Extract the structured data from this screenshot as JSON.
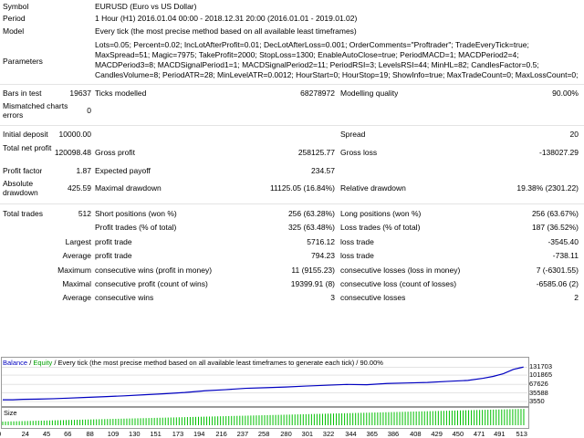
{
  "summary": {
    "symbol": {
      "label": "Symbol",
      "value": "EURUSD (Euro vs US Dollar)"
    },
    "period": {
      "label": "Period",
      "value": "1 Hour (H1) 2016.01.04 00:00 - 2018.12.31 20:00 (2016.01.01 - 2019.01.02)"
    },
    "model": {
      "label": "Model",
      "value": "Every tick (the most precise method based on all available least timeframes)"
    },
    "parameters": {
      "label": "Parameters",
      "value": "Lots=0.05; Percent=0.02; IncLotAfterProfit=0.01; DecLotAfterLoss=0.001; OrderComments=\"Proftrader\"; TradeEveryTick=true; MaxSpread=51; Magic=7975; TakeProfit=2000; StopLoss=1300; EnableAutoClose=true; PeriodMACD=1; MACDPeriod2=4; MACDPeriod3=8; MACDSignalPeriod1=1; MACDSignalPeriod2=11; PeriodRSI=3; LevelsRSI=44; MinHL=82; CandlesFactor=0.5; CandlesVolume=8; PeriodATR=28; MinLevelATR=0.0012; HourStart=0; HourStop=19; ShowInfo=true; MaxTradeCount=0; MaxLossCount=0;"
    }
  },
  "stats": {
    "bars_label": "Bars in test",
    "bars": "19637",
    "ticks_label": "Ticks modelled",
    "ticks": "68278972",
    "mq_label": "Modelling quality",
    "mq": "90.00%",
    "mismatch_label": "Mismatched charts errors",
    "mismatch": "0",
    "deposit_label": "Initial deposit",
    "deposit": "10000.00",
    "spread_label": "Spread",
    "spread": "20",
    "netprofit_label": "Total net profit",
    "netprofit": "120098.48",
    "grossprofit_label": "Gross profit",
    "grossprofit": "258125.77",
    "grossloss_label": "Gross loss",
    "grossloss": "-138027.29",
    "pf_label": "Profit factor",
    "pf": "1.87",
    "ep_label": "Expected payoff",
    "ep": "234.57",
    "absdd_label": "Absolute drawdown",
    "absdd": "425.59",
    "maxdd_label": "Maximal drawdown",
    "maxdd": "11125.05 (16.84%)",
    "reldd_label": "Relative drawdown",
    "reldd": "19.38% (2301.22)",
    "trades_label": "Total trades",
    "trades": "512",
    "short_label": "Short positions (won %)",
    "short": "256 (63.28%)",
    "long_label": "Long positions (won %)",
    "long": "256 (63.67%)",
    "ptrades_label": "Profit trades (% of total)",
    "ptrades": "325 (63.48%)",
    "ltrades_label": "Loss trades (% of total)",
    "ltrades": "187 (36.52%)",
    "largest_label": "Largest",
    "largest_p_label": "profit trade",
    "largest_p": "5716.12",
    "largest_l_label": "loss trade",
    "largest_l": "-3545.40",
    "average_label": "Average",
    "average_p_label": "profit trade",
    "average_p": "794.23",
    "average_l_label": "loss trade",
    "average_l": "-738.11",
    "maximum_label": "Maximum",
    "max_w_label": "consecutive wins (profit in money)",
    "max_w": "11 (9155.23)",
    "max_l_label": "consecutive losses (loss in money)",
    "max_l": "7 (-6301.55)",
    "maximal_label": "Maximal",
    "maxl_w_label": "consecutive profit (count of wins)",
    "maxl_w": "19399.91 (8)",
    "maxl_l_label": "consecutive loss (count of losses)",
    "maxl_l": "-6585.06 (2)",
    "avg2_label": "Average",
    "avg_w_label": "consecutive wins",
    "avg_w": "3",
    "avg_l_label": "consecutive losses",
    "avg_l": "2"
  },
  "legend": {
    "balance": "Balance",
    "sep1": " / ",
    "equity": "Equity",
    "rest": " / Every tick (the most precise method based on all available least timeframes to generate each tick) / 90.00%"
  },
  "size_label": "Size",
  "colors": {
    "balance": "#0000c0",
    "size_bars": "#00c000",
    "grid": "#c8c8c8"
  },
  "chart_data": {
    "type": "line",
    "series": [
      {
        "name": "Balance",
        "x": [
          0,
          10,
          20,
          35,
          50,
          65,
          80,
          100,
          120,
          140,
          160,
          180,
          200,
          220,
          240,
          260,
          280,
          300,
          320,
          340,
          360,
          380,
          400,
          420,
          440,
          460,
          475,
          485,
          495,
          505,
          515
        ],
        "values": [
          10000,
          10000,
          11500,
          12500,
          14000,
          16000,
          18500,
          21500,
          24500,
          28500,
          32500,
          37000,
          43500,
          47500,
          52500,
          55000,
          57500,
          61000,
          64000,
          67000,
          66000,
          70500,
          72500,
          74500,
          78500,
          82000,
          90000,
          97000,
          107000,
          123000,
          131703
        ]
      }
    ],
    "y_ticks": [
      131703,
      101865,
      67626,
      35588,
      3550
    ],
    "x_ticks": [
      0,
      24,
      45,
      66,
      88,
      109,
      130,
      151,
      173,
      194,
      216,
      237,
      258,
      280,
      301,
      322,
      344,
      365,
      386,
      408,
      429,
      450,
      471,
      491,
      513
    ],
    "ylim": [
      3550,
      136000
    ],
    "xlim": [
      0,
      518
    ]
  }
}
